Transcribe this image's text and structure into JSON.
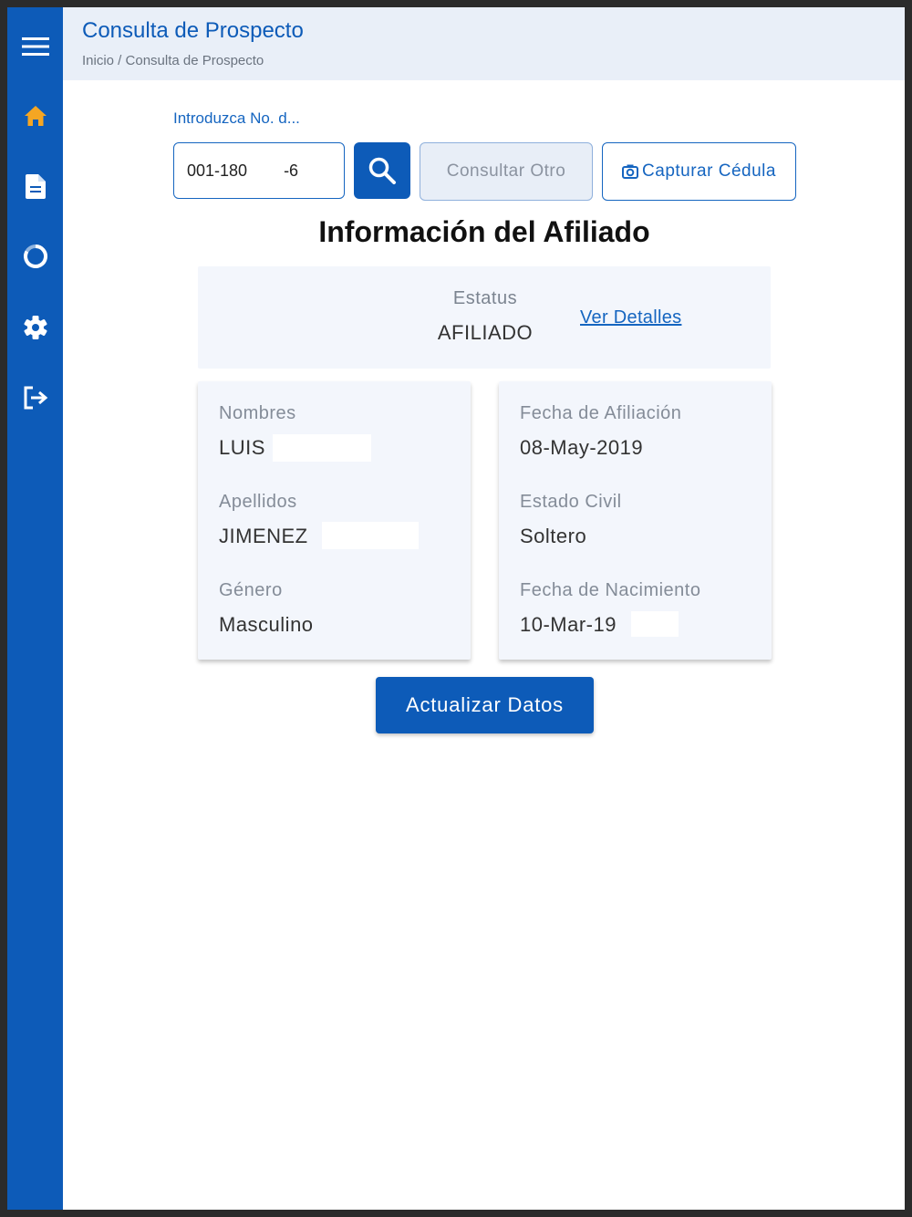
{
  "header": {
    "title": "Consulta de Prospecto",
    "breadcrumb": "Inicio / Consulta de Prospecto"
  },
  "sidebar": {
    "items": [
      {
        "icon": "menu-icon",
        "active": false
      },
      {
        "icon": "home-icon",
        "active": true
      },
      {
        "icon": "document-icon",
        "active": false
      },
      {
        "icon": "refresh-icon",
        "active": false
      },
      {
        "icon": "gear-icon",
        "active": false
      },
      {
        "icon": "logout-icon",
        "active": false
      }
    ],
    "colors": {
      "background": "#0d5bb8",
      "active_icon": "#f5a623",
      "icon": "#ffffff"
    }
  },
  "search": {
    "label": "Introduzca No. d...",
    "value": "001-180        -6"
  },
  "buttons": {
    "consultar_otro": "Consultar Otro",
    "capturar_cedula": "Capturar Cédula",
    "actualizar": "Actualizar Datos"
  },
  "section": {
    "title": "Información del Afiliado"
  },
  "status": {
    "label": "Estatus",
    "value": "AFILIADO",
    "details_link": "Ver Detalles"
  },
  "left_card": {
    "nombres_label": "Nombres",
    "nombres_value": "LUIS",
    "apellidos_label": "Apellidos",
    "apellidos_value": "JIMENEZ",
    "genero_label": "Género",
    "genero_value": "Masculino"
  },
  "right_card": {
    "afiliacion_label": "Fecha de Afiliación",
    "afiliacion_value": "08-May-2019",
    "estado_civil_label": "Estado Civil",
    "estado_civil_value": "Soltero",
    "nacimiento_label": "Fecha de Nacimiento",
    "nacimiento_value": "10-Mar-19"
  },
  "colors": {
    "primary": "#0d5bb8",
    "header_bg": "#e9eff8",
    "card_bg": "#f3f6fc"
  }
}
